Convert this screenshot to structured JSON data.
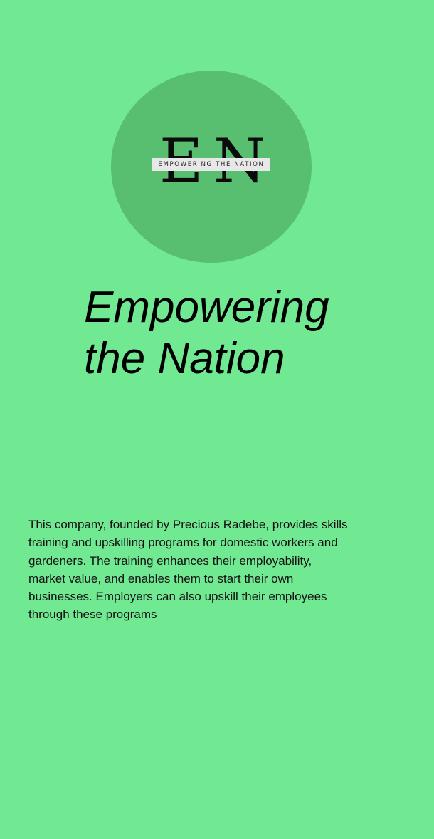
{
  "logo": {
    "letter_left": "E",
    "letter_right": "N",
    "tagline": "EMPOWERING THE NATION"
  },
  "hero": {
    "title": "Empowering the Nation"
  },
  "about": {
    "text": "This company, founded by Precious Radebe, provides skills training and upskilling programs for domestic workers and gardeners. The training enhances their employability, market value, and enables them to start their own businesses. Employers can also upskill their employees through these programs"
  },
  "colors": {
    "background": "#71e892",
    "logo_circle": "#58bf71",
    "text": "#000000"
  }
}
